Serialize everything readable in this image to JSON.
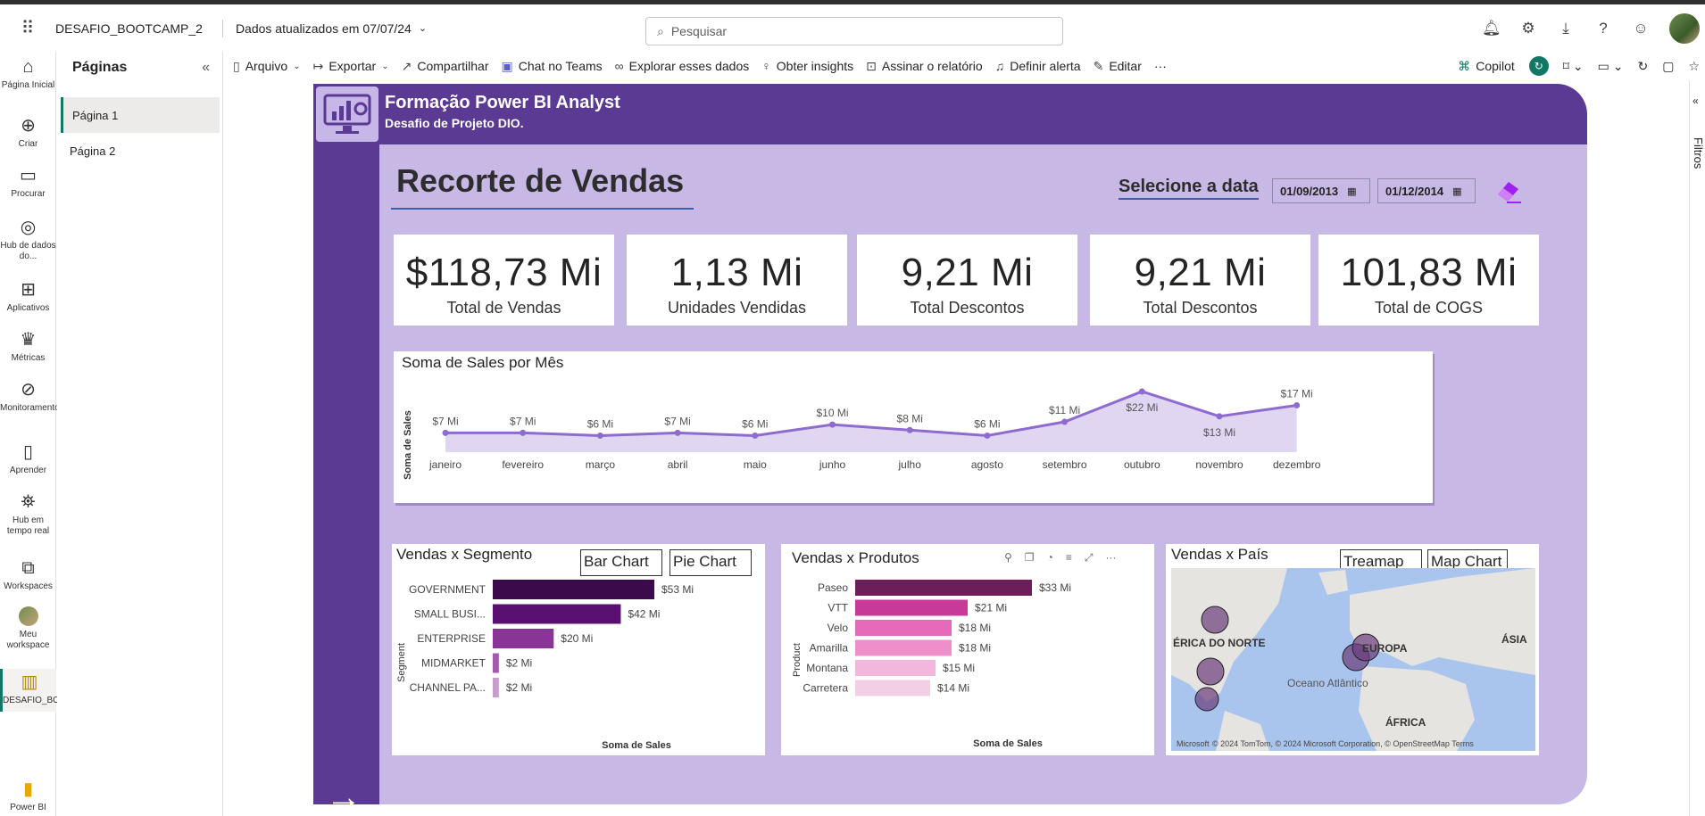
{
  "topbar": {
    "app_title": "DESAFIO_BOOTCAMP_2",
    "updated": "Dados atualizados em 07/07/24",
    "search_placeholder": "Pesquisar"
  },
  "rail": [
    {
      "label": "Página Inicial",
      "icon": "home-icon"
    },
    {
      "label": "Criar",
      "icon": "plus-icon"
    },
    {
      "label": "Procurar",
      "icon": "folder-icon"
    },
    {
      "label": "Hub de dados do...",
      "icon": "data-hub-icon"
    },
    {
      "label": "Aplicativos",
      "icon": "apps-icon"
    },
    {
      "label": "Métricas",
      "icon": "trophy-icon"
    },
    {
      "label": "Monitoramento",
      "icon": "monitor-icon"
    },
    {
      "label": "Aprender",
      "icon": "book-icon"
    },
    {
      "label": "Hub em tempo real",
      "icon": "realtime-icon"
    },
    {
      "label": "Workspaces",
      "icon": "workspaces-icon"
    },
    {
      "label": "Meu workspace",
      "icon": "avatar"
    },
    {
      "label": "DESAFIO_BOOTCAMP...",
      "icon": "report-icon"
    },
    {
      "label": "Power BI",
      "icon": "powerbi-icon"
    }
  ],
  "pages": {
    "title": "Páginas",
    "items": [
      "Página 1",
      "Página 2"
    ]
  },
  "toolbar": {
    "arquivo": "Arquivo",
    "exportar": "Exportar",
    "compartilhar": "Compartilhar",
    "chat": "Chat no Teams",
    "explorar": "Explorar esses dados",
    "insights": "Obter insights",
    "assinar": "Assinar o relatório",
    "alerta": "Definir alerta",
    "editar": "Editar",
    "more": "···",
    "copilot": "Copilot"
  },
  "filters_label": "Filtros",
  "report": {
    "title": "Formação Power BI Analyst",
    "subtitle": "Desafio de Projeto DIO.",
    "main_title": "Recorte de Vendas",
    "date_label": "Selecione a data",
    "date_start": "01/09/2013",
    "date_end": "01/12/2014",
    "kpis": [
      {
        "value": "$118,73 Mi",
        "label": "Total de Vendas"
      },
      {
        "value": "1,13 Mi",
        "label": "Unidades Vendidas"
      },
      {
        "value": "9,21 Mi",
        "label": "Total Descontos"
      },
      {
        "value": "9,21 Mi",
        "label": "Total Descontos"
      },
      {
        "value": "101,83 Mi",
        "label": "Total de COGS"
      }
    ],
    "segment_card": {
      "title": "Vendas x Segmento",
      "btn1": "Bar Chart",
      "btn2": "Pie Chart"
    },
    "product_card": {
      "title": "Vendas x Produtos"
    },
    "country_card": {
      "title": "Vendas x País",
      "btn1": "Treamap",
      "btn2": "Map Chart",
      "labels": [
        "ÉRICA DO NORTE",
        "EUROPA",
        "ÁSIA",
        "Oceano Atlântico",
        "ÁFRICA"
      ],
      "attribution": "© 2024 TomTom, © 2024 Microsoft Corporation, © OpenStreetMap  Terms",
      "ms": "Microsoft"
    }
  },
  "chart_data": [
    {
      "type": "area",
      "title": "Soma de Sales por Mês",
      "ylabel": "Soma de Sales",
      "xlabel": "",
      "categories": [
        "janeiro",
        "fevereiro",
        "março",
        "abril",
        "maio",
        "junho",
        "julho",
        "agosto",
        "setembro",
        "outubro",
        "novembro",
        "dezembro"
      ],
      "values": [
        7,
        7,
        6,
        7,
        6,
        10,
        8,
        6,
        11,
        22,
        13,
        17
      ],
      "data_labels": [
        "$7 Mi",
        "$7 Mi",
        "$6 Mi",
        "$7 Mi",
        "$6 Mi",
        "$10 Mi",
        "$8 Mi",
        "$6 Mi",
        "$11 Mi",
        "$22 Mi",
        "$13 Mi",
        "$17 Mi"
      ],
      "color": "#8e6bd0"
    },
    {
      "type": "bar",
      "title": "Vendas x Segmento",
      "xlabel": "Soma de Sales",
      "ylabel": "Segment",
      "categories": [
        "GOVERNMENT",
        "SMALL BUSI...",
        "ENTERPRISE",
        "MIDMARKET",
        "CHANNEL PA..."
      ],
      "values": [
        53,
        42,
        20,
        2,
        2
      ],
      "data_labels": [
        "$53 Mi",
        "$42 Mi",
        "$20 Mi",
        "$2 Mi",
        "$2 Mi"
      ],
      "colors": [
        "#3a0a4a",
        "#5a1070",
        "#8a3498",
        "#a45aaf",
        "#c89ccd"
      ]
    },
    {
      "type": "bar",
      "title": "Vendas x Produtos",
      "xlabel": "Soma de Sales",
      "ylabel": "Product",
      "categories": [
        "Paseo",
        "VTT",
        "Velo",
        "Amarilla",
        "Montana",
        "Carretera"
      ],
      "values": [
        33,
        21,
        18,
        18,
        15,
        14
      ],
      "data_labels": [
        "$33 Mi",
        "$21 Mi",
        "$18 Mi",
        "$18 Mi",
        "$15 Mi",
        "$14 Mi"
      ],
      "colors": [
        "#6b1e58",
        "#c83a9a",
        "#e769b9",
        "#ee8fc9",
        "#f3b6dd",
        "#f3cfe6"
      ]
    }
  ]
}
